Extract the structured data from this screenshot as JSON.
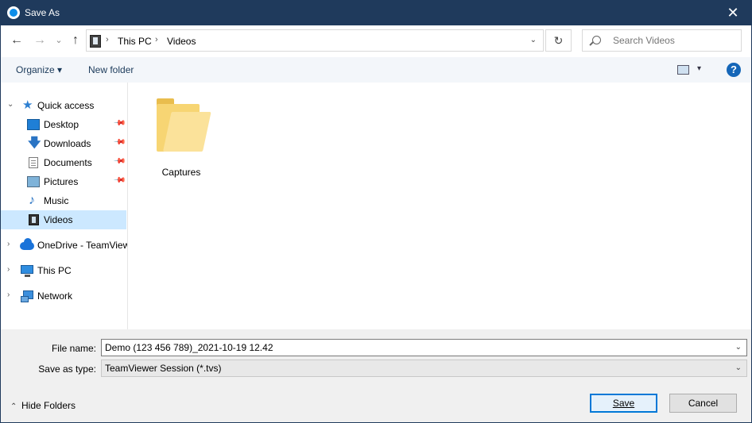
{
  "window": {
    "title": "Save As",
    "close_glyph": "✕",
    "colors": {
      "titlebar": "#1f3a5c",
      "accent": "#0078d7",
      "selected": "#cce8ff"
    }
  },
  "nav": {
    "back_glyph": "←",
    "forward_glyph": "→",
    "recent_glyph": "⌄",
    "up_glyph": "↑",
    "breadcrumb": [
      "This PC",
      "Videos"
    ],
    "breadcrumb_separator": "›",
    "address_dropdown_glyph": "⌄",
    "refresh_glyph": "↻",
    "search_placeholder": "Search Videos"
  },
  "toolbar": {
    "organize_label": "Organize ▾",
    "new_folder_label": "New folder",
    "view_dropdown_glyph": "▾",
    "help_glyph": "?"
  },
  "tree": {
    "quick_access": {
      "label": "Quick access",
      "icon": "star-icon",
      "chevron": "⌄"
    },
    "items": [
      {
        "label": "Desktop",
        "icon": "desktop-icon",
        "pinned": true
      },
      {
        "label": "Downloads",
        "icon": "download-icon",
        "pinned": true
      },
      {
        "label": "Documents",
        "icon": "document-icon",
        "pinned": true
      },
      {
        "label": "Pictures",
        "icon": "pictures-icon",
        "pinned": true
      },
      {
        "label": "Music",
        "icon": "music-icon",
        "pinned": false
      },
      {
        "label": "Videos",
        "icon": "videos-icon",
        "pinned": false,
        "selected": true
      }
    ],
    "roots": [
      {
        "label": "OneDrive - TeamViewer",
        "icon": "onedrive-icon",
        "chevron": "›"
      },
      {
        "label": "This PC",
        "icon": "computer-icon",
        "chevron": "›"
      },
      {
        "label": "Network",
        "icon": "network-icon",
        "chevron": "›"
      }
    ],
    "pin_glyph": "📌",
    "star_glyph": "★",
    "download_glyph": "🡇",
    "music_glyph": "♪"
  },
  "files": [
    {
      "name": "Captures",
      "icon": "folder-icon"
    }
  ],
  "form": {
    "file_name_label": "File name:",
    "file_name_value": "Demo (123 456 789)_2021-10-19 12.42",
    "save_type_label": "Save as type:",
    "save_type_value": "TeamViewer Session (*.tvs)",
    "dropdown_glyph": "⌄"
  },
  "footer": {
    "hide_folders_label": "Hide Folders",
    "hide_folders_chevron": "⌃",
    "save_label": "Save",
    "cancel_label": "Cancel"
  }
}
